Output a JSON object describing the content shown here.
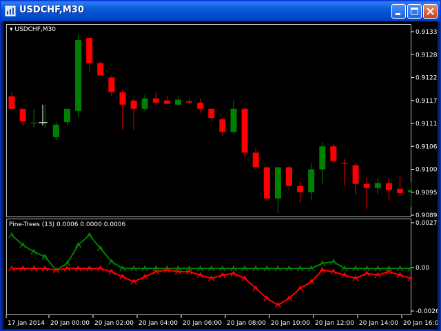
{
  "window": {
    "title": "USDCHF,M30",
    "accent": "#0A5AD8"
  },
  "chart": {
    "symbol_label": "USDCHF,M30",
    "price_ticks": [
      "0.91335",
      "0.91280",
      "0.91225",
      "0.91170",
      "0.91115",
      "0.91060",
      "0.91005",
      "0.90950",
      "0.90895"
    ],
    "up_color": "#008000",
    "down_color": "#FF0000"
  },
  "indicator": {
    "label": "Pine-Trees (13)  0.0006 0.0000 0.0006",
    "ticks": [
      "0.0027",
      "0.00",
      "-0.0026"
    ]
  },
  "time_axis": {
    "labels": [
      "17 Jan 2014",
      "20 Jan 00:00",
      "20 Jan 02:00",
      "20 Jan 04:00",
      "20 Jan 06:00",
      "20 Jan 08:00",
      "20 Jan 10:00",
      "20 Jan 12:00",
      "20 Jan 14:00",
      "20 Jan 16:00"
    ]
  },
  "candles": [
    {
      "o": 0.9118,
      "h": 0.9119,
      "l": 0.9115,
      "c": 0.9115
    },
    {
      "o": 0.9115,
      "h": 0.9115,
      "l": 0.9111,
      "c": 0.9112
    },
    {
      "o": 0.91115,
      "h": 0.9115,
      "l": 0.91105,
      "c": 0.91117
    },
    {
      "o": 0.91118,
      "h": 0.9116,
      "l": 0.91105,
      "c": 0.91118
    },
    {
      "o": 0.91082,
      "h": 0.9112,
      "l": 0.91075,
      "c": 0.91112
    },
    {
      "o": 0.91118,
      "h": 0.9115,
      "l": 0.9111,
      "c": 0.9115
    },
    {
      "o": 0.91145,
      "h": 0.9133,
      "l": 0.9113,
      "c": 0.91315
    },
    {
      "o": 0.9132,
      "h": 0.9132,
      "l": 0.9124,
      "c": 0.9126
    },
    {
      "o": 0.9126,
      "h": 0.91265,
      "l": 0.9123,
      "c": 0.9123
    },
    {
      "o": 0.91225,
      "h": 0.9123,
      "l": 0.9118,
      "c": 0.9119
    },
    {
      "o": 0.9119,
      "h": 0.91195,
      "l": 0.911,
      "c": 0.9116
    },
    {
      "o": 0.9117,
      "h": 0.91175,
      "l": 0.911,
      "c": 0.9115
    },
    {
      "o": 0.9115,
      "h": 0.91185,
      "l": 0.91145,
      "c": 0.91175
    },
    {
      "o": 0.91175,
      "h": 0.9119,
      "l": 0.9116,
      "c": 0.91165
    },
    {
      "o": 0.9117,
      "h": 0.9118,
      "l": 0.9116,
      "c": 0.91162
    },
    {
      "o": 0.9116,
      "h": 0.9118,
      "l": 0.91158,
      "c": 0.91172
    },
    {
      "o": 0.91168,
      "h": 0.91175,
      "l": 0.9116,
      "c": 0.91165
    },
    {
      "o": 0.91165,
      "h": 0.91175,
      "l": 0.9114,
      "c": 0.9115
    },
    {
      "o": 0.9115,
      "h": 0.9115,
      "l": 0.9112,
      "c": 0.91128
    },
    {
      "o": 0.91125,
      "h": 0.9113,
      "l": 0.91085,
      "c": 0.91095
    },
    {
      "o": 0.91095,
      "h": 0.9117,
      "l": 0.9109,
      "c": 0.9115
    },
    {
      "o": 0.9115,
      "h": 0.91155,
      "l": 0.91035,
      "c": 0.91045
    },
    {
      "o": 0.91045,
      "h": 0.91055,
      "l": 0.91005,
      "c": 0.9101
    },
    {
      "o": 0.9101,
      "h": 0.9101,
      "l": 0.9093,
      "c": 0.90935
    },
    {
      "o": 0.90935,
      "h": 0.9101,
      "l": 0.909,
      "c": 0.9101
    },
    {
      "o": 0.9101,
      "h": 0.91015,
      "l": 0.90955,
      "c": 0.90965
    },
    {
      "o": 0.90965,
      "h": 0.90975,
      "l": 0.90925,
      "c": 0.9095
    },
    {
      "o": 0.9095,
      "h": 0.9102,
      "l": 0.9093,
      "c": 0.91005
    },
    {
      "o": 0.91005,
      "h": 0.9107,
      "l": 0.9097,
      "c": 0.9106
    },
    {
      "o": 0.9106,
      "h": 0.91065,
      "l": 0.9102,
      "c": 0.91025
    },
    {
      "o": 0.9102,
      "h": 0.9103,
      "l": 0.90965,
      "c": 0.91018
    },
    {
      "o": 0.91015,
      "h": 0.9102,
      "l": 0.90945,
      "c": 0.9097
    },
    {
      "o": 0.9097,
      "h": 0.90985,
      "l": 0.9091,
      "c": 0.9096
    },
    {
      "o": 0.9096,
      "h": 0.90985,
      "l": 0.90945,
      "c": 0.90972
    },
    {
      "o": 0.90972,
      "h": 0.90985,
      "l": 0.9093,
      "c": 0.90955
    },
    {
      "o": 0.90958,
      "h": 0.9099,
      "l": 0.9094,
      "c": 0.90948
    },
    {
      "o": 0.9095,
      "h": 0.90975,
      "l": 0.90915,
      "c": 0.90955
    }
  ],
  "osc_green": [
    0.002,
    0.0014,
    0.001,
    0.0007,
    -0.0001,
    0.0003,
    0.0014,
    0.002,
    0.0012,
    0.0004,
    0.0,
    0.0,
    0.0,
    0.0,
    0.0,
    0.0,
    0.0,
    0.0,
    0.0,
    0.0,
    0.0,
    0.0,
    0.0,
    0.0,
    0.0,
    0.0,
    0.0,
    0.0,
    0.0003,
    0.0004,
    0.0,
    0.0,
    0.0,
    0.0,
    0.0,
    0.0,
    0.0
  ],
  "osc_red": [
    0.0,
    0.0,
    0.0,
    0.0,
    -0.0001,
    0.0,
    0.0,
    0.0,
    0.0,
    -0.0002,
    -0.0005,
    -0.0008,
    -0.0005,
    -0.0002,
    -0.0001,
    -0.0002,
    -0.0002,
    -0.0004,
    -0.0006,
    -0.0004,
    -0.0003,
    -0.0006,
    -0.0012,
    -0.0018,
    -0.0022,
    -0.0018,
    -0.0012,
    -0.0008,
    -0.0001,
    -0.0002,
    -0.0004,
    -0.0006,
    -0.0003,
    -0.0004,
    -0.0002,
    -0.0004,
    -0.0006
  ]
}
